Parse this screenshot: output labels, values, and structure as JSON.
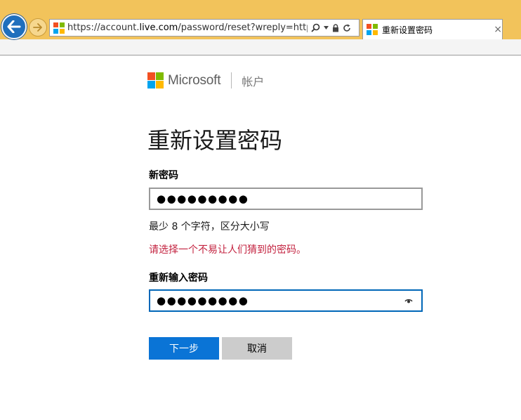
{
  "browser": {
    "url_prefix": "https://account.",
    "url_domain": "live.com",
    "url_suffix": "/password/reset?wreply=https://log",
    "tab_title": "重新设置密码",
    "tab_close": "×"
  },
  "brand": {
    "name": "Microsoft",
    "section": "帐户",
    "colors": [
      "#f25022",
      "#7fba00",
      "#00a4ef",
      "#ffb900"
    ]
  },
  "form": {
    "title": "重新设置密码",
    "new_password_label": "新密码",
    "new_password_value": "●●●●●●●●●",
    "hint": "最少 8 个字符，区分大小写",
    "error": "请选择一个不易让人们猜到的密码。",
    "confirm_label": "重新输入密码",
    "confirm_value": "●●●●●●●●●"
  },
  "buttons": {
    "next": "下一步",
    "cancel": "取消"
  }
}
